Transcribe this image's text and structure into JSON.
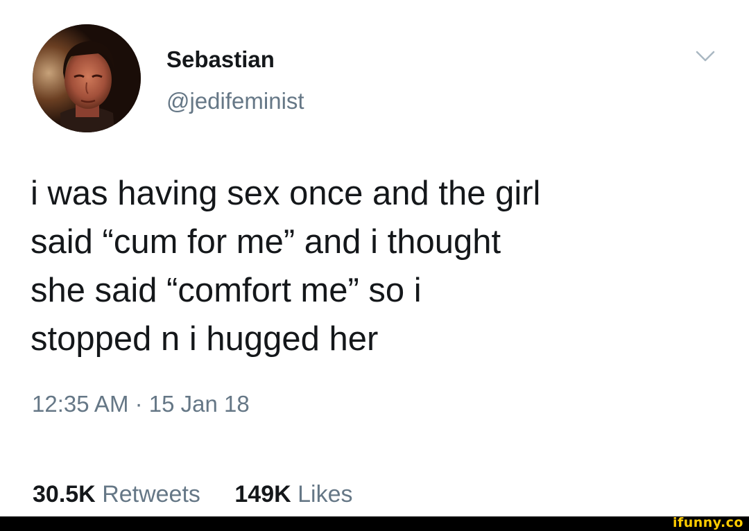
{
  "tweet": {
    "display_name": "Sebastian",
    "handle": "@jedifeminist",
    "menu_icon": "chevron-down-icon",
    "avatar_icon": "profile-photo",
    "text_lines": [
      "i was having sex once and the girl",
      "said “cum for me” and i thought",
      "she said “comfort me” so i",
      "stopped n i hugged her"
    ],
    "timestamp": "12:35 AM · 15 Jan 18",
    "retweets_count": "30.5K",
    "retweets_label": "Retweets",
    "likes_count": "149K",
    "likes_label": "Likes"
  },
  "watermark": {
    "text": "ifunny.co",
    "color": "#ffcc00"
  },
  "colors": {
    "text_primary": "#14171a",
    "text_secondary": "#657786",
    "background": "#ffffff",
    "footer": "#000000"
  }
}
